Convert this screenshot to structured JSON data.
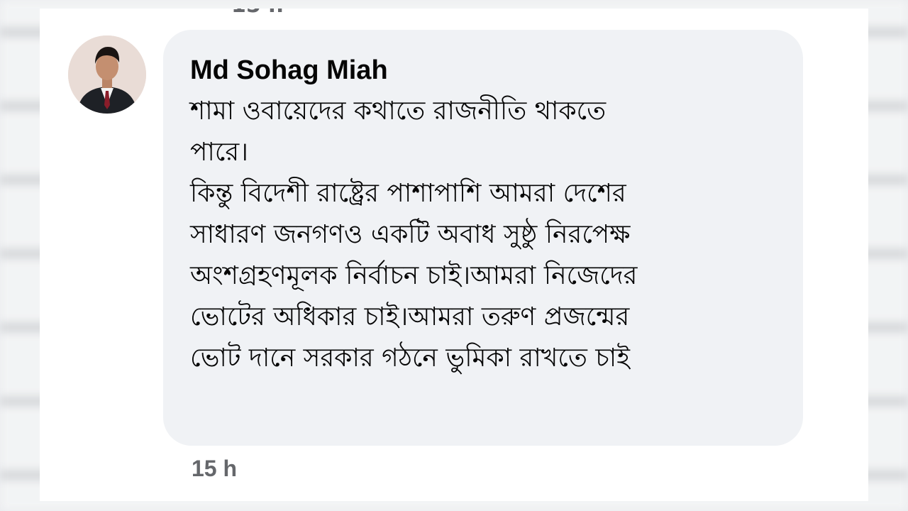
{
  "comment": {
    "author": "Md Sohag Miah",
    "lines": [
      "শামা ওবায়েদের কথাতে রাজনীতি থাকতে",
      "পারে।",
      "কিন্তু বিদেশী রাষ্ট্রের পাশাপাশি আমরা দেশের",
      "সাধারণ জনগণও একটি অবাধ সুষ্ঠু নিরপেক্ষ",
      "অংশগ্রহণমূলক নির্বাচন চাই।আমরা নিজেদের",
      "ভোটের অধিকার চাই।আমরা তরুণ প্রজন্মের",
      "ভোট দানে সরকার গঠনে ভুমিকা রাখতে চাই"
    ],
    "timestamp": "15 h"
  },
  "previous_comment": {
    "timestamp_fragment": "15 h"
  },
  "icons": {
    "avatar": "profile-photo-avatar"
  },
  "colors": {
    "bubble_background": "#f0f2f5",
    "author_text": "#050505",
    "timestamp_text": "#65676b",
    "card_background": "#ffffff"
  }
}
